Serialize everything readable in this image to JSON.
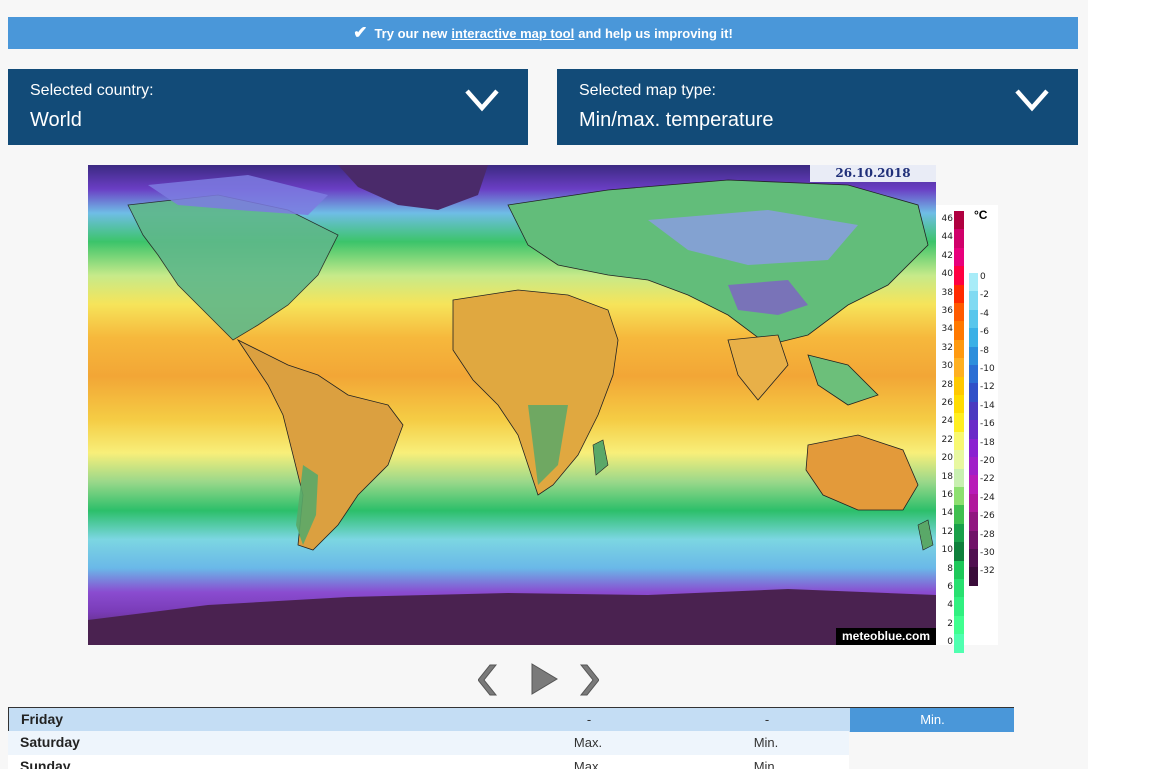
{
  "banner": {
    "prefix": "Try our new",
    "link": "interactive map tool",
    "suffix": "and help us improving it!"
  },
  "selectors": {
    "country": {
      "label": "Selected country:",
      "value": "World"
    },
    "map_type": {
      "label": "Selected map type:",
      "value": "Min/max. temperature"
    }
  },
  "map": {
    "date": "26.10.2018",
    "credit": "meteoblue.com"
  },
  "legend": {
    "unit": "°C",
    "warm_scale": [
      "46",
      "44",
      "42",
      "40",
      "38",
      "36",
      "34",
      "32",
      "30",
      "28",
      "26",
      "24",
      "22",
      "20",
      "18",
      "16",
      "14",
      "12",
      "10",
      "8",
      "6",
      "4",
      "2",
      "0"
    ],
    "cold_scale": [
      "0",
      "-2",
      "-4",
      "-6",
      "-8",
      "-10",
      "-12",
      "-14",
      "-16",
      "-18",
      "-20",
      "-22",
      "-24",
      "-26",
      "-28",
      "-30",
      "-32"
    ],
    "warm_colors": [
      "#b00040",
      "#d0006a",
      "#e8007c",
      "#ff0040",
      "#ff2a00",
      "#ff5a00",
      "#ff7800",
      "#ff9a10",
      "#ffb020",
      "#ffc800",
      "#ffdc00",
      "#ffee20",
      "#f8f870",
      "#e8f8a0",
      "#c8f0b0",
      "#8de070",
      "#40c050",
      "#1aa04a",
      "#0f803c",
      "#1ec85a",
      "#28e070",
      "#30f080",
      "#40ff90",
      "#50ffb0"
    ],
    "cold_colors": [
      "#a8ecf8",
      "#80daf2",
      "#58c6ec",
      "#3ab0e6",
      "#2c8edc",
      "#2a6ed4",
      "#3050c8",
      "#4a3ac0",
      "#6a2ac8",
      "#8a22d0",
      "#a020c8",
      "#b81cb8",
      "#b0189c",
      "#901680",
      "#701268",
      "#501050",
      "#3a0c3a"
    ]
  },
  "controls": {
    "prev": "previous-frame",
    "play": "play",
    "next": "next-frame"
  },
  "days": [
    {
      "name": "Friday",
      "col1": "-",
      "col2": "-",
      "selected": "Min."
    },
    {
      "name": "Saturday",
      "col1": "Max.",
      "col2": "Min."
    },
    {
      "name": "Sunday",
      "col1": "Max.",
      "col2": "Min."
    }
  ]
}
